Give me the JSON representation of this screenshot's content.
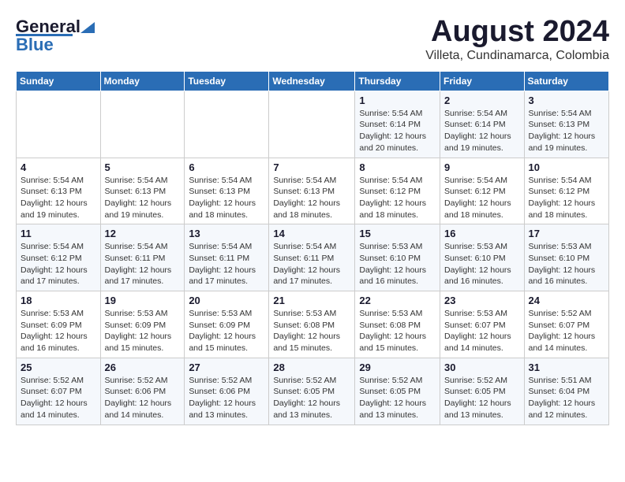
{
  "header": {
    "logo": {
      "general": "General",
      "blue": "Blue"
    },
    "title": "August 2024",
    "subtitle": "Villeta, Cundinamarca, Colombia"
  },
  "weekdays": [
    "Sunday",
    "Monday",
    "Tuesday",
    "Wednesday",
    "Thursday",
    "Friday",
    "Saturday"
  ],
  "weeks": [
    [
      {
        "day": "",
        "info": ""
      },
      {
        "day": "",
        "info": ""
      },
      {
        "day": "",
        "info": ""
      },
      {
        "day": "",
        "info": ""
      },
      {
        "day": "1",
        "info": "Sunrise: 5:54 AM\nSunset: 6:14 PM\nDaylight: 12 hours\nand 20 minutes."
      },
      {
        "day": "2",
        "info": "Sunrise: 5:54 AM\nSunset: 6:14 PM\nDaylight: 12 hours\nand 19 minutes."
      },
      {
        "day": "3",
        "info": "Sunrise: 5:54 AM\nSunset: 6:13 PM\nDaylight: 12 hours\nand 19 minutes."
      }
    ],
    [
      {
        "day": "4",
        "info": "Sunrise: 5:54 AM\nSunset: 6:13 PM\nDaylight: 12 hours\nand 19 minutes."
      },
      {
        "day": "5",
        "info": "Sunrise: 5:54 AM\nSunset: 6:13 PM\nDaylight: 12 hours\nand 19 minutes."
      },
      {
        "day": "6",
        "info": "Sunrise: 5:54 AM\nSunset: 6:13 PM\nDaylight: 12 hours\nand 18 minutes."
      },
      {
        "day": "7",
        "info": "Sunrise: 5:54 AM\nSunset: 6:13 PM\nDaylight: 12 hours\nand 18 minutes."
      },
      {
        "day": "8",
        "info": "Sunrise: 5:54 AM\nSunset: 6:12 PM\nDaylight: 12 hours\nand 18 minutes."
      },
      {
        "day": "9",
        "info": "Sunrise: 5:54 AM\nSunset: 6:12 PM\nDaylight: 12 hours\nand 18 minutes."
      },
      {
        "day": "10",
        "info": "Sunrise: 5:54 AM\nSunset: 6:12 PM\nDaylight: 12 hours\nand 18 minutes."
      }
    ],
    [
      {
        "day": "11",
        "info": "Sunrise: 5:54 AM\nSunset: 6:12 PM\nDaylight: 12 hours\nand 17 minutes."
      },
      {
        "day": "12",
        "info": "Sunrise: 5:54 AM\nSunset: 6:11 PM\nDaylight: 12 hours\nand 17 minutes."
      },
      {
        "day": "13",
        "info": "Sunrise: 5:54 AM\nSunset: 6:11 PM\nDaylight: 12 hours\nand 17 minutes."
      },
      {
        "day": "14",
        "info": "Sunrise: 5:54 AM\nSunset: 6:11 PM\nDaylight: 12 hours\nand 17 minutes."
      },
      {
        "day": "15",
        "info": "Sunrise: 5:53 AM\nSunset: 6:10 PM\nDaylight: 12 hours\nand 16 minutes."
      },
      {
        "day": "16",
        "info": "Sunrise: 5:53 AM\nSunset: 6:10 PM\nDaylight: 12 hours\nand 16 minutes."
      },
      {
        "day": "17",
        "info": "Sunrise: 5:53 AM\nSunset: 6:10 PM\nDaylight: 12 hours\nand 16 minutes."
      }
    ],
    [
      {
        "day": "18",
        "info": "Sunrise: 5:53 AM\nSunset: 6:09 PM\nDaylight: 12 hours\nand 16 minutes."
      },
      {
        "day": "19",
        "info": "Sunrise: 5:53 AM\nSunset: 6:09 PM\nDaylight: 12 hours\nand 15 minutes."
      },
      {
        "day": "20",
        "info": "Sunrise: 5:53 AM\nSunset: 6:09 PM\nDaylight: 12 hours\nand 15 minutes."
      },
      {
        "day": "21",
        "info": "Sunrise: 5:53 AM\nSunset: 6:08 PM\nDaylight: 12 hours\nand 15 minutes."
      },
      {
        "day": "22",
        "info": "Sunrise: 5:53 AM\nSunset: 6:08 PM\nDaylight: 12 hours\nand 15 minutes."
      },
      {
        "day": "23",
        "info": "Sunrise: 5:53 AM\nSunset: 6:07 PM\nDaylight: 12 hours\nand 14 minutes."
      },
      {
        "day": "24",
        "info": "Sunrise: 5:52 AM\nSunset: 6:07 PM\nDaylight: 12 hours\nand 14 minutes."
      }
    ],
    [
      {
        "day": "25",
        "info": "Sunrise: 5:52 AM\nSunset: 6:07 PM\nDaylight: 12 hours\nand 14 minutes."
      },
      {
        "day": "26",
        "info": "Sunrise: 5:52 AM\nSunset: 6:06 PM\nDaylight: 12 hours\nand 14 minutes."
      },
      {
        "day": "27",
        "info": "Sunrise: 5:52 AM\nSunset: 6:06 PM\nDaylight: 12 hours\nand 13 minutes."
      },
      {
        "day": "28",
        "info": "Sunrise: 5:52 AM\nSunset: 6:05 PM\nDaylight: 12 hours\nand 13 minutes."
      },
      {
        "day": "29",
        "info": "Sunrise: 5:52 AM\nSunset: 6:05 PM\nDaylight: 12 hours\nand 13 minutes."
      },
      {
        "day": "30",
        "info": "Sunrise: 5:52 AM\nSunset: 6:05 PM\nDaylight: 12 hours\nand 13 minutes."
      },
      {
        "day": "31",
        "info": "Sunrise: 5:51 AM\nSunset: 6:04 PM\nDaylight: 12 hours\nand 12 minutes."
      }
    ]
  ]
}
